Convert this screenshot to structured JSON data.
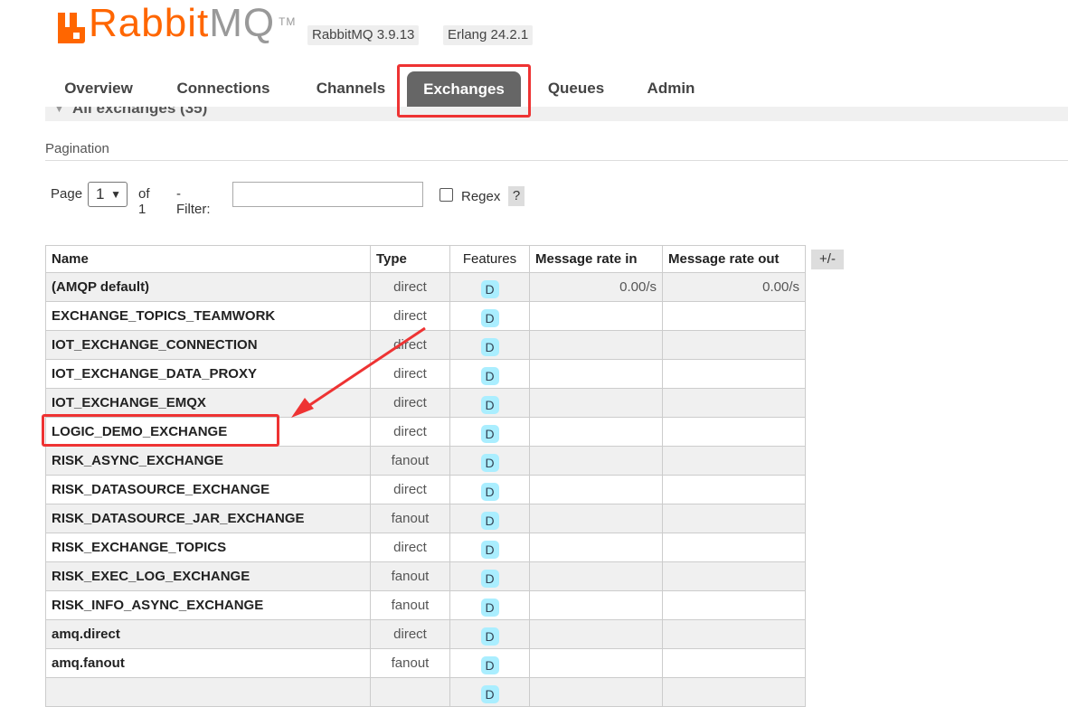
{
  "brand": {
    "name_a": "Rabbit",
    "name_b": "MQ",
    "tm": "TM"
  },
  "versions": {
    "rabbitmq": "RabbitMQ 3.9.13",
    "erlang": "Erlang 24.2.1"
  },
  "tabs": [
    {
      "label": "Overview",
      "active": false
    },
    {
      "label": "Connections",
      "active": false
    },
    {
      "label": "Channels",
      "active": false
    },
    {
      "label": "Exchanges",
      "active": true
    },
    {
      "label": "Queues",
      "active": false
    },
    {
      "label": "Admin",
      "active": false
    }
  ],
  "section": {
    "title": "All exchanges (35)"
  },
  "pagination": {
    "title": "Pagination",
    "page_label": "Page",
    "page_value": "1",
    "of_label": "of 1",
    "filter_label": "- Filter:",
    "filter_value": "",
    "regex_label": "Regex",
    "regex_checked": false,
    "help": "?"
  },
  "table": {
    "headers": [
      "Name",
      "Type",
      "Features",
      "Message rate in",
      "Message rate out"
    ],
    "toggle": "+/-",
    "rows": [
      {
        "name": "(AMQP default)",
        "type": "direct",
        "feature": "D",
        "rate_in": "0.00/s",
        "rate_out": "0.00/s"
      },
      {
        "name": "EXCHANGE_TOPICS_TEAMWORK",
        "type": "direct",
        "feature": "D",
        "rate_in": "",
        "rate_out": ""
      },
      {
        "name": "IOT_EXCHANGE_CONNECTION",
        "type": "direct",
        "feature": "D",
        "rate_in": "",
        "rate_out": ""
      },
      {
        "name": "IOT_EXCHANGE_DATA_PROXY",
        "type": "direct",
        "feature": "D",
        "rate_in": "",
        "rate_out": ""
      },
      {
        "name": "IOT_EXCHANGE_EMQX",
        "type": "direct",
        "feature": "D",
        "rate_in": "",
        "rate_out": ""
      },
      {
        "name": "LOGIC_DEMO_EXCHANGE",
        "type": "direct",
        "feature": "D",
        "rate_in": "",
        "rate_out": ""
      },
      {
        "name": "RISK_ASYNC_EXCHANGE",
        "type": "fanout",
        "feature": "D",
        "rate_in": "",
        "rate_out": ""
      },
      {
        "name": "RISK_DATASOURCE_EXCHANGE",
        "type": "direct",
        "feature": "D",
        "rate_in": "",
        "rate_out": ""
      },
      {
        "name": "RISK_DATASOURCE_JAR_EXCHANGE",
        "type": "fanout",
        "feature": "D",
        "rate_in": "",
        "rate_out": ""
      },
      {
        "name": "RISK_EXCHANGE_TOPICS",
        "type": "direct",
        "feature": "D",
        "rate_in": "",
        "rate_out": ""
      },
      {
        "name": "RISK_EXEC_LOG_EXCHANGE",
        "type": "fanout",
        "feature": "D",
        "rate_in": "",
        "rate_out": ""
      },
      {
        "name": "RISK_INFO_ASYNC_EXCHANGE",
        "type": "fanout",
        "feature": "D",
        "rate_in": "",
        "rate_out": ""
      },
      {
        "name": "amq.direct",
        "type": "direct",
        "feature": "D",
        "rate_in": "",
        "rate_out": ""
      },
      {
        "name": "amq.fanout",
        "type": "fanout",
        "feature": "D",
        "rate_in": "",
        "rate_out": ""
      },
      {
        "name": "",
        "type": "",
        "feature": "D",
        "rate_in": "",
        "rate_out": ""
      }
    ]
  },
  "colors": {
    "brand": "#ff6600",
    "tab_active": "#666666",
    "badge": "#aaeeff",
    "annotation": "#ee3333"
  }
}
